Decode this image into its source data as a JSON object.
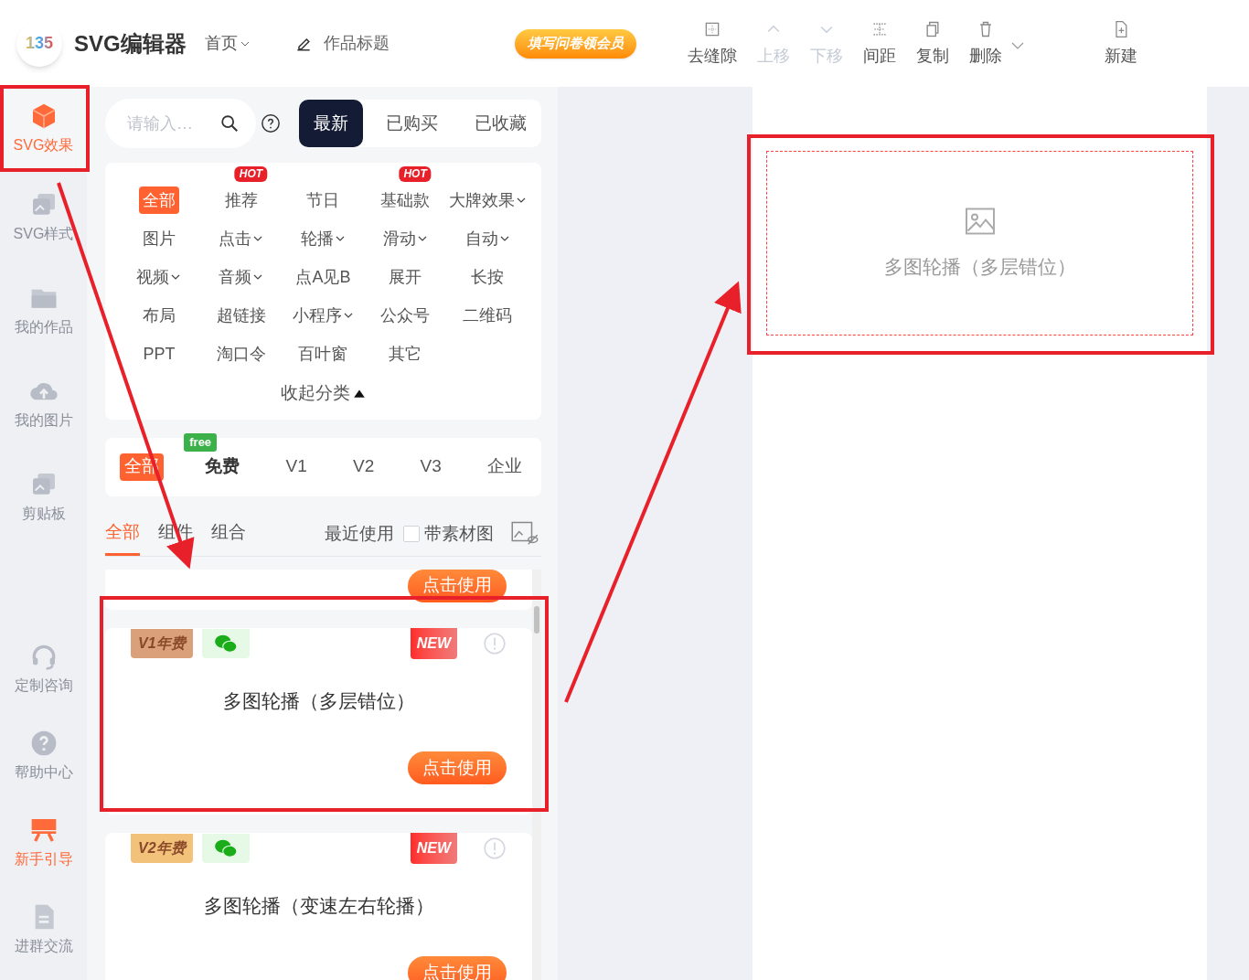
{
  "header": {
    "logo": "135",
    "title": "SVG编辑器",
    "nav": "首页",
    "work_title": "作品标题",
    "promo": "填写问卷领会员",
    "toolbar": [
      {
        "label": "去缝隙",
        "disabled": false
      },
      {
        "label": "上移",
        "disabled": true
      },
      {
        "label": "下移",
        "disabled": true
      },
      {
        "label": "间距",
        "disabled": false
      },
      {
        "label": "复制",
        "disabled": false
      },
      {
        "label": "删除",
        "disabled": false,
        "dropdown": true
      },
      {
        "label": "新建",
        "disabled": false
      }
    ]
  },
  "sidebar": {
    "top_items": [
      {
        "label": "SVG效果",
        "highlighted": true
      },
      {
        "label": "SVG样式",
        "highlighted": false
      },
      {
        "label": "我的作品",
        "highlighted": false
      },
      {
        "label": "我的图片",
        "highlighted": false
      },
      {
        "label": "剪贴板",
        "highlighted": false
      }
    ],
    "bottom_items": [
      {
        "label": "定制咨询",
        "highlighted": false
      },
      {
        "label": "帮助中心",
        "highlighted": false
      },
      {
        "label": "新手引导",
        "highlighted": true
      },
      {
        "label": "进群交流",
        "highlighted": false
      }
    ]
  },
  "panel": {
    "search": {
      "placeholder": "请输入…"
    },
    "sort_tabs": [
      {
        "label": "最新",
        "selected": true
      },
      {
        "label": "已购买",
        "selected": false
      },
      {
        "label": "已收藏",
        "selected": false
      }
    ],
    "categories": [
      {
        "label": "全部",
        "selected": true,
        "dropdown": false
      },
      {
        "label": "推荐",
        "selected": false,
        "dropdown": false,
        "badge": "HOT"
      },
      {
        "label": "节日",
        "selected": false,
        "dropdown": false
      },
      {
        "label": "基础款",
        "selected": false,
        "dropdown": false,
        "badge": "HOT"
      },
      {
        "label": "大牌效果",
        "selected": false,
        "dropdown": true
      },
      {
        "label": "图片",
        "selected": false,
        "dropdown": false
      },
      {
        "label": "点击",
        "selected": false,
        "dropdown": true
      },
      {
        "label": "轮播",
        "selected": false,
        "dropdown": true
      },
      {
        "label": "滑动",
        "selected": false,
        "dropdown": true
      },
      {
        "label": "自动",
        "selected": false,
        "dropdown": true
      },
      {
        "label": "视频",
        "selected": false,
        "dropdown": true
      },
      {
        "label": "音频",
        "selected": false,
        "dropdown": true
      },
      {
        "label": "点A见B",
        "selected": false,
        "dropdown": false
      },
      {
        "label": "展开",
        "selected": false,
        "dropdown": false
      },
      {
        "label": "长按",
        "selected": false,
        "dropdown": false
      },
      {
        "label": "布局",
        "selected": false,
        "dropdown": false
      },
      {
        "label": "超链接",
        "selected": false,
        "dropdown": false
      },
      {
        "label": "小程序",
        "selected": false,
        "dropdown": true
      },
      {
        "label": "公众号",
        "selected": false,
        "dropdown": false
      },
      {
        "label": "二维码",
        "selected": false,
        "dropdown": false
      },
      {
        "label": "PPT",
        "selected": false,
        "dropdown": false
      },
      {
        "label": "淘口令",
        "selected": false,
        "dropdown": false
      },
      {
        "label": "百叶窗",
        "selected": false,
        "dropdown": false
      },
      {
        "label": "其它",
        "selected": false,
        "dropdown": false
      }
    ],
    "collapse": "收起分类",
    "tiers": [
      {
        "label": "全部",
        "selected": true
      },
      {
        "label": "免费",
        "selected": false,
        "badge": "free"
      },
      {
        "label": "V1",
        "selected": false
      },
      {
        "label": "V2",
        "selected": false
      },
      {
        "label": "V3",
        "selected": false
      },
      {
        "label": "企业",
        "selected": false
      }
    ],
    "sub_tabs": [
      {
        "label": "全部",
        "selected": true
      },
      {
        "label": "组件",
        "selected": false
      },
      {
        "label": "组合",
        "selected": false
      }
    ],
    "recent": "最近使用",
    "with_material": {
      "label": "带素材图",
      "checked": false
    },
    "cards": [
      {
        "kind": "partial",
        "button": "点击使用"
      },
      {
        "kind": "full",
        "tier": "V1年费",
        "new": "NEW",
        "title": "多图轮播（多层错位）",
        "button": "点击使用"
      },
      {
        "kind": "full",
        "tier": "V2年费",
        "new": "NEW",
        "title": "多图轮播（变速左右轮播）",
        "button": "点击使用"
      }
    ]
  },
  "canvas": {
    "placeholder": "多图轮播（多层错位）"
  }
}
